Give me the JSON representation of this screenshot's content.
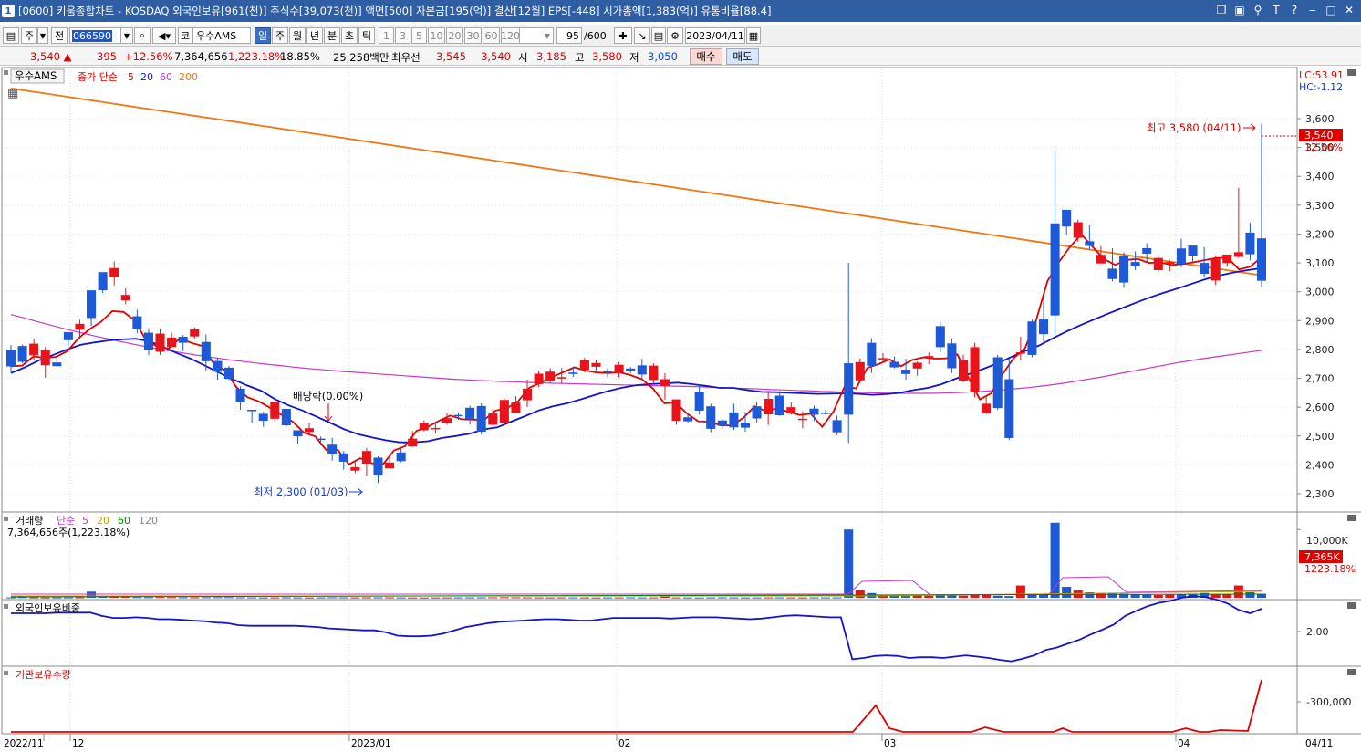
{
  "window": {
    "number": "1",
    "title": "[0600] 키움종합차트 - KOSDAQ 외국인보유[961(천)] 주식수[39,073(천)] 액면[500] 자본금[195(억)] 결산[12월] EPS[-448] 시가총액[1,383(억)] 유통비율[88.4]",
    "icons": [
      "restore-icon",
      "tile-icon",
      "pin-icon",
      "text-icon",
      "help-icon",
      "minimize-icon",
      "maximize-icon",
      "close-icon"
    ]
  },
  "toolbar": {
    "period_select": "주",
    "prev_label": "전",
    "code": "066590",
    "name": "우수AMS",
    "market_label": "코",
    "timeframes": [
      "일",
      "주",
      "월",
      "년",
      "분",
      "초",
      "틱"
    ],
    "intervals": [
      "1",
      "3",
      "5",
      "10",
      "20",
      "30",
      "60",
      "120"
    ],
    "count": "95",
    "count_total": "/600",
    "date": "2023/04/11"
  },
  "quote": {
    "price": "3,540",
    "change": "395",
    "change_pct": "+12.56%",
    "volume": "7,364,656",
    "volume_pct": "1,223.18%",
    "turnover_pct": "18.85%",
    "amount": "25,258백만",
    "best_label": "최우선",
    "ask": "3,545",
    "bid": "3,540",
    "open_label": "시",
    "open": "3,185",
    "high_label": "고",
    "high": "3,580",
    "low_label": "저",
    "low": "3,050",
    "buy_label": "매수",
    "sell_label": "매도"
  },
  "price_panel": {
    "name": "우수AMS",
    "legend_prefix": "종가 단순",
    "ma": [
      "5",
      "20",
      "60",
      "200"
    ],
    "lc": "LC:53.91",
    "hc": "HC:-1.12",
    "price_tag": "3,540",
    "pct_tag": "12.56%",
    "annot_high": "최고 3,580 (04/11)",
    "annot_low": "최저 2,300 (01/03)",
    "annot_div": "배당락(0.00%)",
    "yticks": [
      "3,600",
      "3,500",
      "3,400",
      "3,300",
      "3,200",
      "3,100",
      "3,000",
      "2,900",
      "2,800",
      "2,700",
      "2,600",
      "2,500",
      "2,400",
      "2,300"
    ]
  },
  "volume_panel": {
    "title": "거래량",
    "legend_prefix": "단순",
    "ma": [
      "5",
      "20",
      "60",
      "120"
    ],
    "value": "7,364,656주(1,223.18%)",
    "ytick": "10,000K",
    "vol_tag": "7,365K",
    "pct_tag": "1223.18%"
  },
  "foreign_panel": {
    "title": "외국인보유비중",
    "ytick": "2.00"
  },
  "inst_panel": {
    "title": "기관보유수량",
    "ytick": "-300,000"
  },
  "xaxis": {
    "labels": [
      "2022/11",
      "12",
      "2023/01",
      "02",
      "03",
      "04"
    ],
    "right": "04/11"
  },
  "colors": {
    "up": "#e8141b",
    "down": "#1e5ad8",
    "ma5": "#e00000",
    "ma20": "#1414c8",
    "ma60": "#c837c8",
    "ma200": "#f07814"
  },
  "chart_data": {
    "type": "candlestick",
    "series": [
      {
        "name": "캔들",
        "open": [
          2798,
          2812,
          2780,
          2745,
          2755,
          2860,
          2868,
          3005,
          3068,
          3050,
          2970,
          2915,
          2858,
          2792,
          2808,
          2844,
          2845,
          2826,
          2760,
          2737,
          2664,
          2591,
          2577,
          2560,
          2594,
          2520,
          2514,
          2491,
          2470,
          2440,
          2380,
          2404,
          2425,
          2388,
          2443,
          2464,
          2520,
          2526,
          2544,
          2573,
          2598,
          2604,
          2539,
          2544,
          2580,
          2624,
          2680,
          2690,
          2699,
          2720,
          2730,
          2740,
          2725,
          2720,
          2734,
          2745,
          2694,
          2674,
          2553,
          2565,
          2652,
          2603,
          2554,
          2582,
          2545,
          2603,
          2575,
          2640,
          2579,
          2557,
          2595,
          2581,
          2555,
          2752,
          2693,
          2823,
          2770,
          2757,
          2730,
          2734,
          2769,
          2881,
          2821,
          2692,
          2652,
          2579,
          2773,
          2697,
          2787,
          2897,
          2904,
          3237,
          3284,
          3187,
          3175,
          3098,
          3080,
          3123,
          3103,
          3151,
          3075,
          3097,
          3150,
          3160,
          3100,
          3039,
          3099,
          3121,
          3205,
          3185
        ],
        "close": [
          2741,
          2757,
          2820,
          2798,
          2742,
          2832,
          2889,
          2909,
          3005,
          3082,
          2989,
          2871,
          2799,
          2855,
          2841,
          2823,
          2870,
          2759,
          2723,
          2698,
          2617,
          2590,
          2553,
          2618,
          2537,
          2499,
          2527,
          2490,
          2436,
          2411,
          2392,
          2448,
          2363,
          2408,
          2413,
          2491,
          2546,
          2528,
          2562,
          2570,
          2560,
          2515,
          2578,
          2625,
          2616,
          2664,
          2716,
          2723,
          2704,
          2715,
          2763,
          2753,
          2720,
          2747,
          2727,
          2713,
          2744,
          2697,
          2627,
          2551,
          2588,
          2525,
          2535,
          2530,
          2529,
          2561,
          2629,
          2572,
          2600,
          2560,
          2574,
          2578,
          2513,
          2574,
          2756,
          2743,
          2770,
          2738,
          2715,
          2754,
          2777,
          2808,
          2735,
          2763,
          2808,
          2612,
          2597,
          2493,
          2790,
          2781,
          2853,
          2918,
          3226,
          3241,
          3159,
          3128,
          3044,
          3032,
          3089,
          3132,
          3117,
          3103,
          3096,
          3125,
          3062,
          3114,
          3129,
          3137,
          3130,
          3038,
          3108,
          3540
        ],
        "high": [
          2815,
          2817,
          2837,
          2808,
          2770,
          2854,
          2903,
          2917,
          3020,
          3105,
          3012,
          2938,
          2874,
          2873,
          2858,
          2850,
          2877,
          2852,
          2771,
          2743,
          2672,
          2591,
          2584,
          2629,
          2594,
          2520,
          2544,
          2498,
          2494,
          2448,
          2411,
          2459,
          2430,
          2423,
          2461,
          2517,
          2554,
          2548,
          2582,
          2581,
          2605,
          2613,
          2595,
          2630,
          2638,
          2695,
          2726,
          2735,
          2736,
          2739,
          2771,
          2763,
          2734,
          2756,
          2739,
          2768,
          2752,
          2718,
          2627,
          2574,
          2680,
          2612,
          2558,
          2612,
          2583,
          2618,
          2651,
          2656,
          2616,
          2586,
          2605,
          2591,
          2571,
          3100,
          2769,
          2839,
          2787,
          2775,
          2768,
          2759,
          2789,
          2896,
          2837,
          2782,
          2823,
          2641,
          2781,
          2769,
          2844,
          2904,
          2979,
          3488,
          3284,
          3250,
          3230,
          3158,
          3151,
          3136,
          3140,
          3168,
          3127,
          3109,
          3184,
          3160,
          3155,
          3126,
          3123,
          3360,
          3240,
          3583
        ],
        "low": [
          2718,
          2752,
          2765,
          2702,
          2742,
          2811,
          2837,
          2882,
          2996,
          3022,
          2957,
          2856,
          2781,
          2781,
          2808,
          2794,
          2835,
          2728,
          2695,
          2694,
          2591,
          2545,
          2532,
          2549,
          2532,
          2473,
          2508,
          2467,
          2415,
          2383,
          2372,
          2360,
          2338,
          2396,
          2409,
          2462,
          2516,
          2508,
          2539,
          2556,
          2540,
          2505,
          2532,
          2542,
          2579,
          2601,
          2669,
          2682,
          2681,
          2705,
          2721,
          2728,
          2703,
          2703,
          2718,
          2694,
          2682,
          2626,
          2539,
          2544,
          2574,
          2513,
          2527,
          2521,
          2515,
          2546,
          2538,
          2570,
          2574,
          2527,
          2552,
          2574,
          2503,
          2476,
          2684,
          2719,
          2756,
          2735,
          2695,
          2709,
          2749,
          2790,
          2718,
          2686,
          2634,
          2577,
          2591,
          2486,
          2763,
          2773,
          2828,
          2850,
          3196,
          3173,
          3146,
          3099,
          3036,
          3014,
          3075,
          3104,
          3068,
          3072,
          3085,
          3098,
          3052,
          3023,
          3086,
          3117,
          3108,
          3017,
          3050,
          3185
        ]
      },
      {
        "name": "종가 단순 5",
        "values": [
          2742,
          2744,
          2776,
          2771,
          2774,
          2794,
          2839,
          2871,
          2896,
          2933,
          2930,
          2900,
          2831,
          2810,
          2803,
          2839,
          2823,
          2812,
          2751,
          2728,
          2670,
          2634,
          2620,
          2598,
          2574,
          2550,
          2512,
          2499,
          2451,
          2452,
          2402,
          2423,
          2406,
          2401,
          2450,
          2465,
          2518,
          2532,
          2553,
          2571,
          2558,
          2557,
          2556,
          2588,
          2596,
          2620,
          2667,
          2685,
          2704,
          2721,
          2738,
          2727,
          2720,
          2718,
          2721,
          2711,
          2697,
          2664,
          2613,
          2616,
          2578,
          2551,
          2550,
          2537,
          2537,
          2563,
          2603,
          2586,
          2596,
          2584,
          2573,
          2577,
          2532,
          2584,
          2673,
          2665,
          2736,
          2749,
          2766,
          2742,
          2764,
          2773,
          2768,
          2769,
          2783,
          2701,
          2627,
          2648,
          2714,
          2770,
          2804,
          2903,
          3037,
          3102,
          3156,
          3199,
          3156,
          3114,
          3093,
          3110,
          3114,
          3100,
          3102,
          3093,
          3096,
          3102,
          3110,
          3117,
          3118,
          3077,
          3087,
          3120
        ]
      },
      {
        "name": "단순 20",
        "values": [
          2718,
          2738,
          2762,
          2780,
          2799,
          2816,
          2824,
          2831,
          2835,
          2837,
          2828,
          2808,
          2786,
          2767,
          2743,
          2719,
          2696,
          2675,
          2657,
          2628,
          2606,
          2588,
          2567,
          2545,
          2523,
          2506,
          2495,
          2485,
          2478,
          2478,
          2482,
          2493,
          2500,
          2508,
          2523,
          2530,
          2550,
          2569,
          2589,
          2603,
          2613,
          2627,
          2642,
          2656,
          2668,
          2676,
          2680,
          2682,
          2685,
          2680,
          2674,
          2667,
          2667,
          2659,
          2653,
          2652,
          2650,
          2648,
          2646,
          2647,
          2648,
          2646,
          2643,
          2645,
          2650,
          2660,
          2667,
          2680,
          2699,
          2716,
          2733,
          2752,
          2774,
          2795,
          2814,
          2839,
          2863,
          2885,
          2905,
          2925,
          2944,
          2963,
          2981,
          2997,
          3012,
          3028,
          3044,
          3057,
          3067,
          3075,
          3082
        ]
      },
      {
        "name": "단순 60",
        "values": [
          2921,
          2910,
          2898,
          2887,
          2876,
          2865,
          2855,
          2845,
          2836,
          2827,
          2818,
          2810,
          2802,
          2795,
          2788,
          2781,
          2775,
          2769,
          2763,
          2758,
          2753,
          2748,
          2744,
          2739,
          2735,
          2731,
          2728,
          2724,
          2721,
          2718,
          2715,
          2712,
          2709,
          2706,
          2703,
          2700,
          2697,
          2695,
          2693,
          2691,
          2689,
          2688,
          2686,
          2685,
          2683,
          2682,
          2681,
          2680,
          2679,
          2678,
          2677,
          2676,
          2675,
          2674,
          2673,
          2672,
          2671,
          2669,
          2668,
          2666,
          2665,
          2663,
          2661,
          2660,
          2658,
          2657,
          2655,
          2654,
          2652,
          2651,
          2650,
          2649,
          2648,
          2648,
          2648,
          2648,
          2649,
          2650,
          2652,
          2654,
          2657,
          2660,
          2664,
          2668,
          2673,
          2678,
          2684,
          2691,
          2698,
          2705,
          2713,
          2721,
          2729,
          2737,
          2745,
          2753,
          2760,
          2767,
          2773,
          2779,
          2785,
          2791,
          2797
        ]
      },
      {
        "name": "단순 200",
        "values": [
          3705,
          3693,
          3681,
          3669,
          3657,
          3645,
          3633,
          3621,
          3609,
          3597,
          3585,
          3573,
          3561,
          3549,
          3537,
          3525,
          3513,
          3501,
          3489,
          3477,
          3465,
          3453,
          3441,
          3429,
          3417,
          3405,
          3393,
          3381,
          3369,
          3357,
          3345,
          3333,
          3321,
          3309,
          3297,
          3285,
          3273,
          3261,
          3249,
          3237,
          3225,
          3213,
          3201,
          3189,
          3177,
          3165,
          3153,
          3141,
          3129,
          3117,
          3105,
          3093,
          3081,
          3069,
          3057
        ]
      },
      {
        "name": "거래량",
        "values": [
          60,
          90,
          55,
          45,
          50,
          60,
          70,
          900,
          210,
          190,
          120,
          90,
          80,
          95,
          85,
          70,
          65,
          75,
          80,
          85,
          60,
          55,
          45,
          50,
          60,
          45,
          40,
          50,
          70,
          60,
          50,
          55,
          60,
          55,
          45,
          40,
          35,
          40,
          45,
          50,
          55,
          60,
          70,
          80,
          70,
          60,
          50,
          45,
          55,
          50,
          45,
          40,
          50,
          55,
          60,
          50,
          55,
          170,
          50,
          45,
          40,
          50,
          60,
          55,
          45,
          50,
          55,
          60,
          50,
          45,
          55,
          50,
          60,
          10000,
          1100,
          700,
          400,
          300,
          250,
          350,
          300,
          500,
          350,
          300,
          400,
          450,
          300,
          250,
          1800,
          450,
          400,
          11000,
          1600,
          1100,
          800,
          700,
          650,
          600,
          500,
          450,
          400,
          450,
          500,
          600,
          700,
          500,
          550,
          1800,
          800,
          600,
          600,
          7365
        ]
      },
      {
        "name": "외국인보유비중",
        "values": [
          2.55,
          2.55,
          2.55,
          2.55,
          2.56,
          2.56,
          2.56,
          2.56,
          2.51,
          2.48,
          2.48,
          2.49,
          2.48,
          2.46,
          2.46,
          2.45,
          2.44,
          2.43,
          2.41,
          2.4,
          2.37,
          2.36,
          2.36,
          2.36,
          2.36,
          2.36,
          2.35,
          2.34,
          2.32,
          2.31,
          2.3,
          2.29,
          2.29,
          2.26,
          2.21,
          2.2,
          2.2,
          2.21,
          2.24,
          2.29,
          2.34,
          2.37,
          2.4,
          2.42,
          2.43,
          2.44,
          2.45,
          2.46,
          2.46,
          2.45,
          2.44,
          2.44,
          2.46,
          2.48,
          2.48,
          2.48,
          2.48,
          2.48,
          2.47,
          2.48,
          2.49,
          2.49,
          2.49,
          2.48,
          2.47,
          2.46,
          2.47,
          2.49,
          2.51,
          2.52,
          2.51,
          2.5,
          2.49,
          2.49,
          1.85,
          1.87,
          1.9,
          1.91,
          1.9,
          1.87,
          1.88,
          1.88,
          1.87,
          1.89,
          1.91,
          1.89,
          1.87,
          1.84,
          1.82,
          1.86,
          1.91,
          1.99,
          2.03,
          2.09,
          2.15,
          2.23,
          2.3,
          2.38,
          2.51,
          2.59,
          2.66,
          2.71,
          2.74,
          2.79,
          2.81,
          2.8,
          2.76,
          2.7,
          2.6,
          2.55,
          2.62
        ]
      }
    ],
    "x_labels": [
      "2022/11",
      "12",
      "2023/01",
      "02",
      "03",
      "04",
      "04/11"
    ],
    "ylim": [
      2250,
      3700
    ]
  },
  "inst_path_note": "기관보유수량 flat near zero with peaks"
}
